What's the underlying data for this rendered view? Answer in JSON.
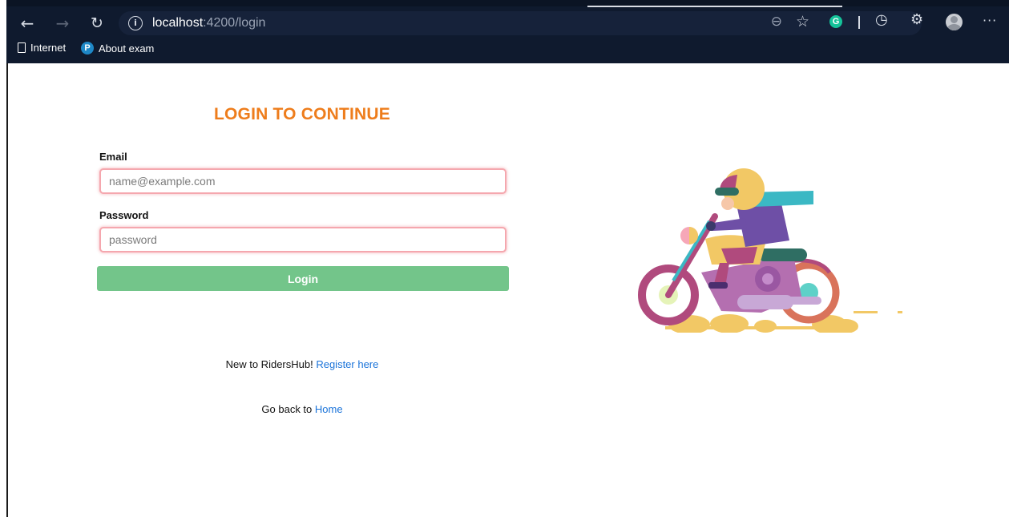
{
  "browser": {
    "url_host": "localhost",
    "url_path": ":4200/login",
    "grammarly_letter": "G",
    "bookmarks": [
      {
        "label": "Internet",
        "icon": "page-icon"
      },
      {
        "label": "About exam",
        "icon": "p-icon",
        "icon_letter": "P"
      }
    ],
    "icons": [
      "back-icon",
      "forward-icon",
      "refresh-icon",
      "info-icon",
      "zoom-out-icon",
      "favorites-icon",
      "grammarly-icon",
      "history-icon",
      "extensions-icon",
      "profile-icon",
      "more-icon"
    ]
  },
  "page": {
    "heading": "LOGIN TO CONTINUE",
    "email_label": "Email",
    "email_placeholder": "name@example.com",
    "password_label": "Password",
    "password_placeholder": "password",
    "login_label": "Login",
    "register_prefix": "New to RidersHub! ",
    "register_link": "Register here",
    "home_prefix": "Go back to ",
    "home_link": "Home"
  },
  "colors": {
    "accent": "#ee7d1c",
    "button": "#73c58a",
    "link": "#1a73d9",
    "input_border": "#f5a7ae",
    "chrome": "#0f1a2e"
  }
}
